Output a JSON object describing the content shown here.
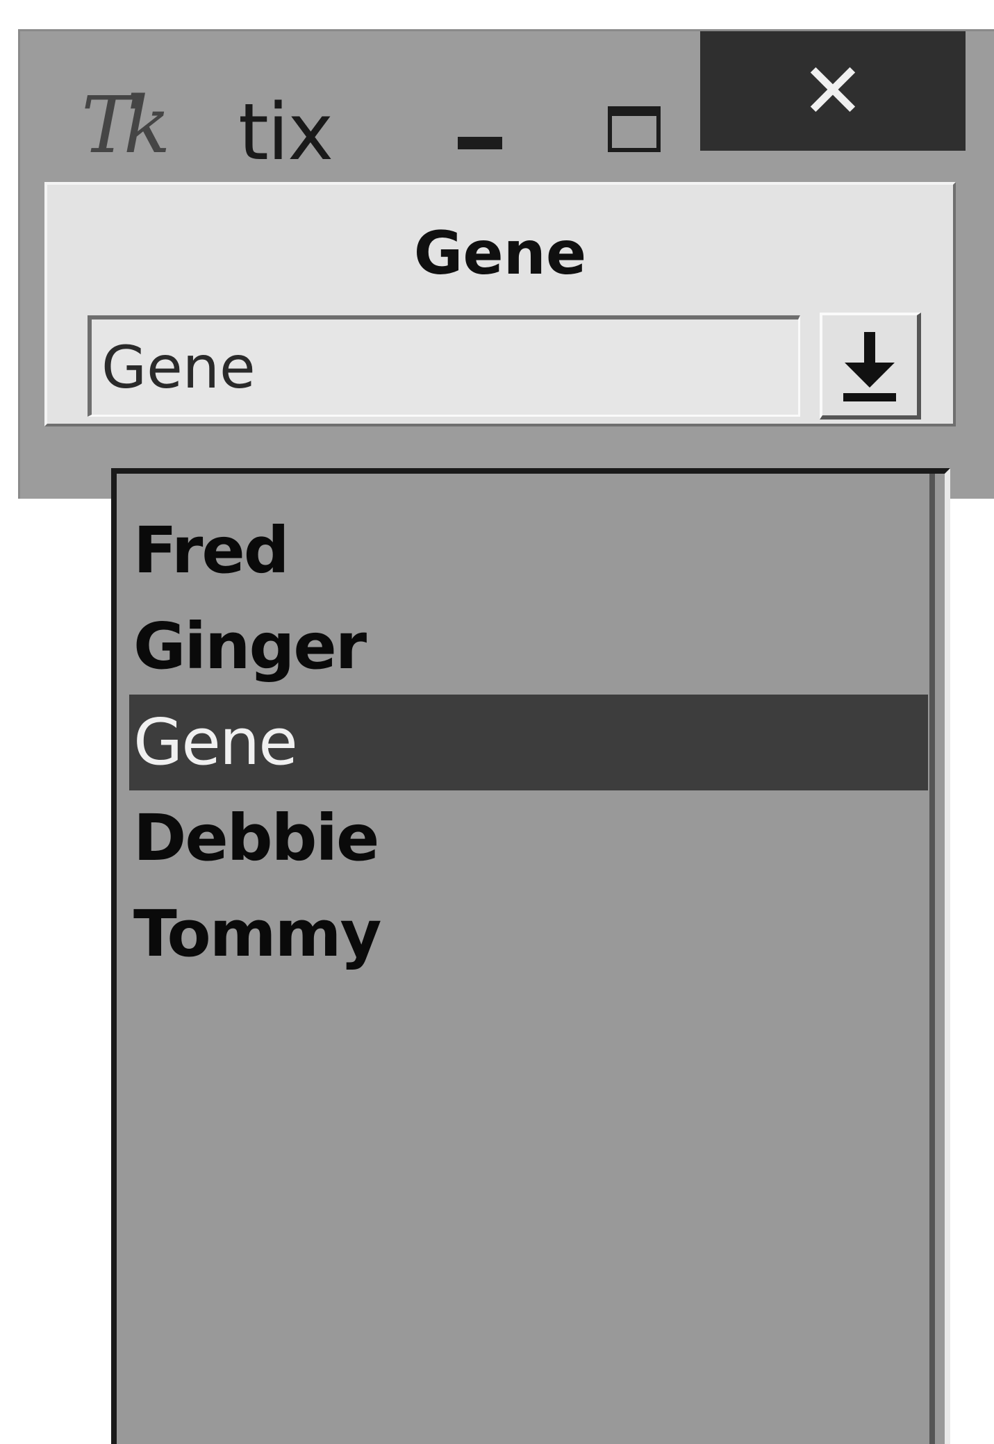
{
  "window": {
    "title": "tix",
    "app_icon": "Tk",
    "close_glyph": "✕"
  },
  "combo": {
    "label": "Gene",
    "value": "Gene",
    "dropdown_button_icon": "download-arrow-icon"
  },
  "listbox": {
    "items": [
      {
        "label": "Fred",
        "selected": false
      },
      {
        "label": "Ginger",
        "selected": false
      },
      {
        "label": "Gene",
        "selected": true
      },
      {
        "label": "Debbie",
        "selected": false
      },
      {
        "label": "Tommy",
        "selected": false
      }
    ]
  },
  "colors": {
    "selection_background": "#3d3d3d",
    "close_button_background": "#2f2f2f",
    "window_background": "#9c9c9c"
  }
}
